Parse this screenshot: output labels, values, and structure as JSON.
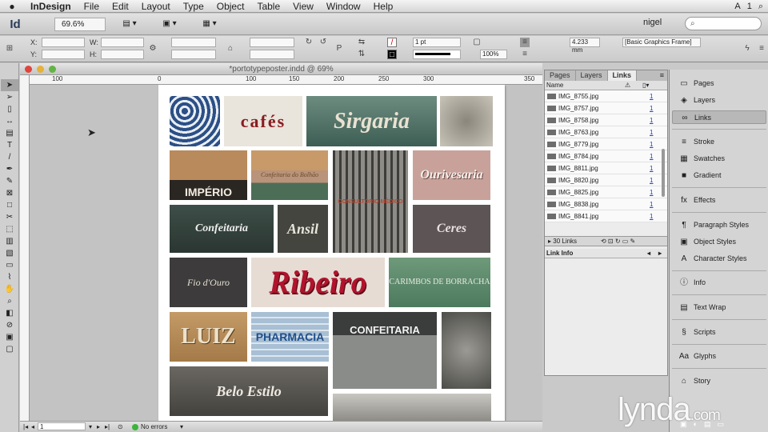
{
  "menubar": {
    "app": "InDesign",
    "items": [
      "File",
      "Edit",
      "Layout",
      "Type",
      "Object",
      "Table",
      "View",
      "Window",
      "Help"
    ],
    "right": "1"
  },
  "appbar": {
    "logo": "Id",
    "zoom": "69.6%",
    "user": "nigel",
    "search_placeholder": ""
  },
  "control": {
    "x_label": "X:",
    "y_label": "Y:",
    "w_label": "W:",
    "h_label": "H:",
    "stroke_weight": "1 pt",
    "dimension": "4.233 mm",
    "opacity": "100%",
    "style": "[Basic Graphics Frame]"
  },
  "document": {
    "title": "*portotypeposter.indd @ 69%",
    "ruler_ticks": [
      "100",
      "0",
      "100",
      "150",
      "200",
      "250",
      "300",
      "350"
    ],
    "page_num": "1",
    "status": "No errors"
  },
  "tiles": [
    {
      "label": "",
      "bg": "#3a5a8a"
    },
    {
      "label": "cafés",
      "bg": "#e9e4dc"
    },
    {
      "label": "Sirgaria",
      "bg": "#4b6e63"
    },
    {
      "label": "",
      "bg": "#b5b0a6"
    },
    {
      "label": "IMPÉRIO",
      "bg": "#5a4a3c"
    },
    {
      "label": "Confeitaria do Bolhão",
      "bg": "#c89a6a"
    },
    {
      "label": "CONSULTÓRIO MÉDICO",
      "bg": "#6b6a66"
    },
    {
      "label": "Ourivesaria",
      "bg": "#c8a29a"
    },
    {
      "label": "Confeitaria",
      "bg": "#3e4e48"
    },
    {
      "label": "Ansil",
      "bg": "#44453f"
    },
    {
      "label": "Ceres",
      "bg": "#5d5555"
    },
    {
      "label": "Fio d'Ouro",
      "bg": "#3d3b3b"
    },
    {
      "label": "Ribeiro",
      "bg": "#e6dcd4"
    },
    {
      "label": "CARIMBOS DE BORRACHA",
      "bg": "#5e8a6c"
    },
    {
      "label": "LUIZ",
      "bg": "#b58a58"
    },
    {
      "label": "PHARMACIA",
      "bg": "#7d98b6"
    },
    {
      "label": "CONFEITARIA",
      "bg": "#5a5d5c"
    },
    {
      "label": "",
      "bg": "#6e6e6a"
    },
    {
      "label": "Belo Estilo",
      "bg": "#55524e"
    },
    {
      "label": "",
      "bg": "#9e9d99"
    }
  ],
  "links_panel": {
    "tabs": [
      "Pages",
      "Layers",
      "Links"
    ],
    "name_header": "Name",
    "items": [
      {
        "name": "IMG_8755.jpg",
        "num": "1"
      },
      {
        "name": "IMG_8757.jpg",
        "num": "1"
      },
      {
        "name": "IMG_8758.jpg",
        "num": "1"
      },
      {
        "name": "IMG_8763.jpg",
        "num": "1"
      },
      {
        "name": "IMG_8779.jpg",
        "num": "1"
      },
      {
        "name": "IMG_8784.jpg",
        "num": "1"
      },
      {
        "name": "IMG_8811.jpg",
        "num": "1"
      },
      {
        "name": "IMG_8820.jpg",
        "num": "1"
      },
      {
        "name": "IMG_8825.jpg",
        "num": "1"
      },
      {
        "name": "IMG_8838.jpg",
        "num": "1"
      },
      {
        "name": "IMG_8841.jpg",
        "num": "1"
      }
    ],
    "count": "30 Links",
    "link_info": "Link Info"
  },
  "dock": {
    "items": [
      {
        "label": "Pages",
        "icon": "pages-icon",
        "glyph": "▭"
      },
      {
        "label": "Layers",
        "icon": "layers-icon",
        "glyph": "◈"
      },
      {
        "label": "Links",
        "icon": "links-icon",
        "glyph": "∞"
      },
      {
        "label": "Stroke",
        "icon": "stroke-icon",
        "glyph": "≡"
      },
      {
        "label": "Swatches",
        "icon": "swatches-icon",
        "glyph": "▦"
      },
      {
        "label": "Gradient",
        "icon": "gradient-icon",
        "glyph": "■"
      },
      {
        "label": "Effects",
        "icon": "effects-icon",
        "glyph": "fx"
      },
      {
        "label": "Paragraph Styles",
        "icon": "paragraph-styles-icon",
        "glyph": "¶"
      },
      {
        "label": "Object Styles",
        "icon": "object-styles-icon",
        "glyph": "▣"
      },
      {
        "label": "Character Styles",
        "icon": "character-styles-icon",
        "glyph": "A"
      },
      {
        "label": "Info",
        "icon": "info-icon",
        "glyph": "ⓘ"
      },
      {
        "label": "Text Wrap",
        "icon": "text-wrap-icon",
        "glyph": "▤"
      },
      {
        "label": "Scripts",
        "icon": "scripts-icon",
        "glyph": "§"
      },
      {
        "label": "Glyphs",
        "icon": "glyphs-icon",
        "glyph": "Aa"
      },
      {
        "label": "Story",
        "icon": "story-icon",
        "glyph": "⌂"
      }
    ]
  },
  "watermark": {
    "main": "lynda",
    "suffix": ".com"
  }
}
